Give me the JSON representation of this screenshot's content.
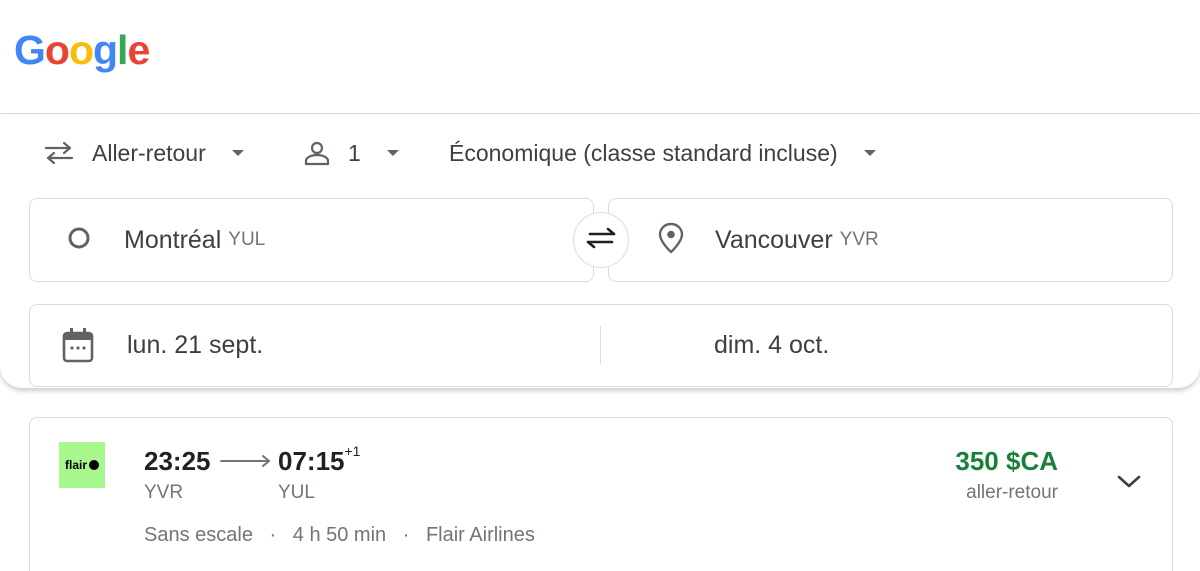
{
  "brand": {
    "letters": [
      "G",
      "o",
      "o",
      "g",
      "l",
      "e"
    ],
    "colors": [
      "#4285f4",
      "#ea4335",
      "#fbbc05",
      "#4285f4",
      "#34a853",
      "#ea4335"
    ]
  },
  "search": {
    "trip_type": "Aller-retour",
    "passengers": "1",
    "cabin_class": "Économique (classe standard incluse)",
    "origin": {
      "name": "Montréal",
      "code": "YUL"
    },
    "destination": {
      "name": "Vancouver",
      "code": "YVR"
    },
    "departure_date": "lun. 21 sept.",
    "return_date": "dim. 4 oct."
  },
  "result": {
    "airline_logo_text": "flair",
    "depart_time": "23:25",
    "arrive_time": "07:15",
    "day_offset": "+1",
    "depart_airport": "YVR",
    "arrive_airport": "YUL",
    "stops": "Sans escale",
    "duration": "4 h 50 min",
    "airline": "Flair Airlines",
    "price": "350 $CA",
    "price_type": "aller-retour"
  },
  "colors": {
    "price": "#188038",
    "flair_logo_bg": "#a8f78c"
  }
}
